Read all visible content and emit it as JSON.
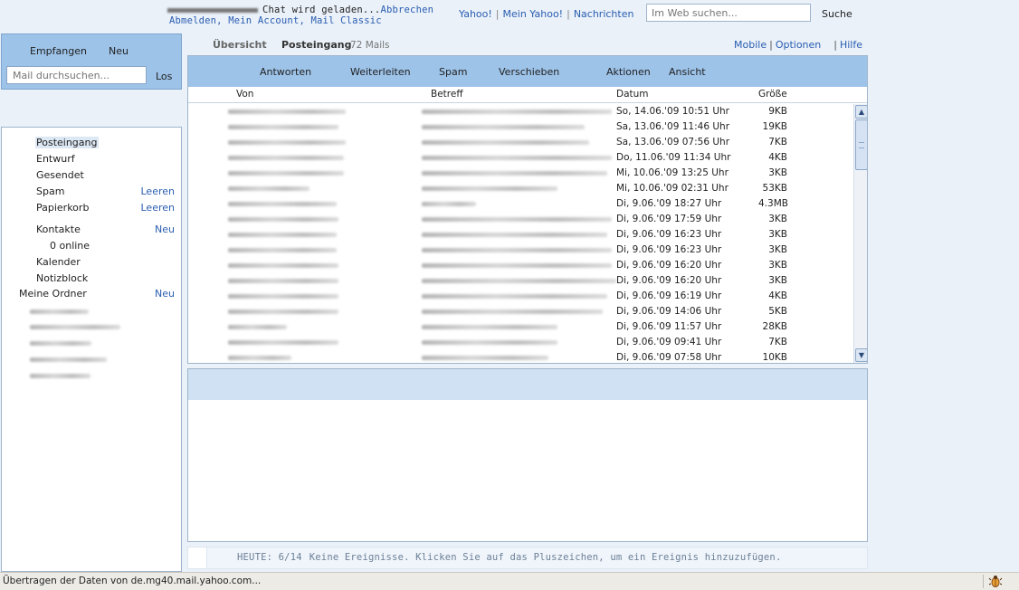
{
  "topbar": {
    "chat_status": "Chat wird geladen...",
    "chat_cancel": "Abbrechen",
    "account_links": "Abmelden, Mein Account, Mail Classic",
    "yahoo_links": [
      "Yahoo!",
      "Mein Yahoo!",
      "Nachrichten"
    ],
    "search_placeholder": "Im Web suchen...",
    "search_button": "Suche"
  },
  "leftpanel": {
    "receive": "Empfangen",
    "new": "Neu",
    "search_placeholder": "Mail durchsuchen...",
    "go": "Los"
  },
  "folders": {
    "inbox": "Posteingang",
    "draft": "Entwurf",
    "sent": "Gesendet",
    "spam": "Spam",
    "spam_action": "Leeren",
    "trash": "Papierkorb",
    "trash_action": "Leeren",
    "contacts": "Kontakte",
    "contacts_action": "Neu",
    "online": "0 online",
    "calendar": "Kalender",
    "notepad": "Notizblock",
    "my_folders": "Meine Ordner",
    "my_folders_action": "Neu"
  },
  "main": {
    "tab_overview": "Übersicht",
    "tab_inbox": "Posteingang",
    "mail_count": "72 Mails",
    "links": [
      "Mobile",
      "Optionen",
      "Hilfe"
    ]
  },
  "toolbar": {
    "reply": "Antworten",
    "forward": "Weiterleiten",
    "spam": "Spam",
    "move": "Verschieben",
    "actions": "Aktionen",
    "view": "Ansicht"
  },
  "columns": {
    "from": "Von",
    "subject": "Betreff",
    "date": "Datum",
    "size": "Größe"
  },
  "messages": [
    {
      "date": "So, 14.06.'09 10:51 Uhr",
      "size": "9KB"
    },
    {
      "date": "Sa, 13.06.'09 11:46 Uhr",
      "size": "19KB"
    },
    {
      "date": "Sa, 13.06.'09 07:56 Uhr",
      "size": "7KB"
    },
    {
      "date": "Do, 11.06.'09 11:34 Uhr",
      "size": "4KB"
    },
    {
      "date": "Mi, 10.06.'09 13:25 Uhr",
      "size": "3KB"
    },
    {
      "date": "Mi, 10.06.'09 02:31 Uhr",
      "size": "53KB"
    },
    {
      "date": "Di, 9.06.'09 18:27 Uhr",
      "size": "4.3MB"
    },
    {
      "date": "Di, 9.06.'09 17:59 Uhr",
      "size": "3KB"
    },
    {
      "date": "Di, 9.06.'09 16:23 Uhr",
      "size": "3KB"
    },
    {
      "date": "Di, 9.06.'09 16:23 Uhr",
      "size": "3KB"
    },
    {
      "date": "Di, 9.06.'09 16:20 Uhr",
      "size": "3KB"
    },
    {
      "date": "Di, 9.06.'09 16:20 Uhr",
      "size": "3KB"
    },
    {
      "date": "Di, 9.06.'09 16:19 Uhr",
      "size": "4KB"
    },
    {
      "date": "Di, 9.06.'09 14:06 Uhr",
      "size": "5KB"
    },
    {
      "date": "Di, 9.06.'09 11:57 Uhr",
      "size": "28KB"
    },
    {
      "date": "Di, 9.06.'09 09:41 Uhr",
      "size": "7KB"
    },
    {
      "date": "Di, 9.06.'09 07:58 Uhr",
      "size": "10KB"
    }
  ],
  "calendar": {
    "today": "HEUTE: 6/14",
    "message": "Keine Ereignisse. Klicken Sie auf das Pluszeichen, um ein Ereignis hinzuzufügen."
  },
  "status": "Übertragen der Daten von de.mg40.mail.yahoo.com..."
}
